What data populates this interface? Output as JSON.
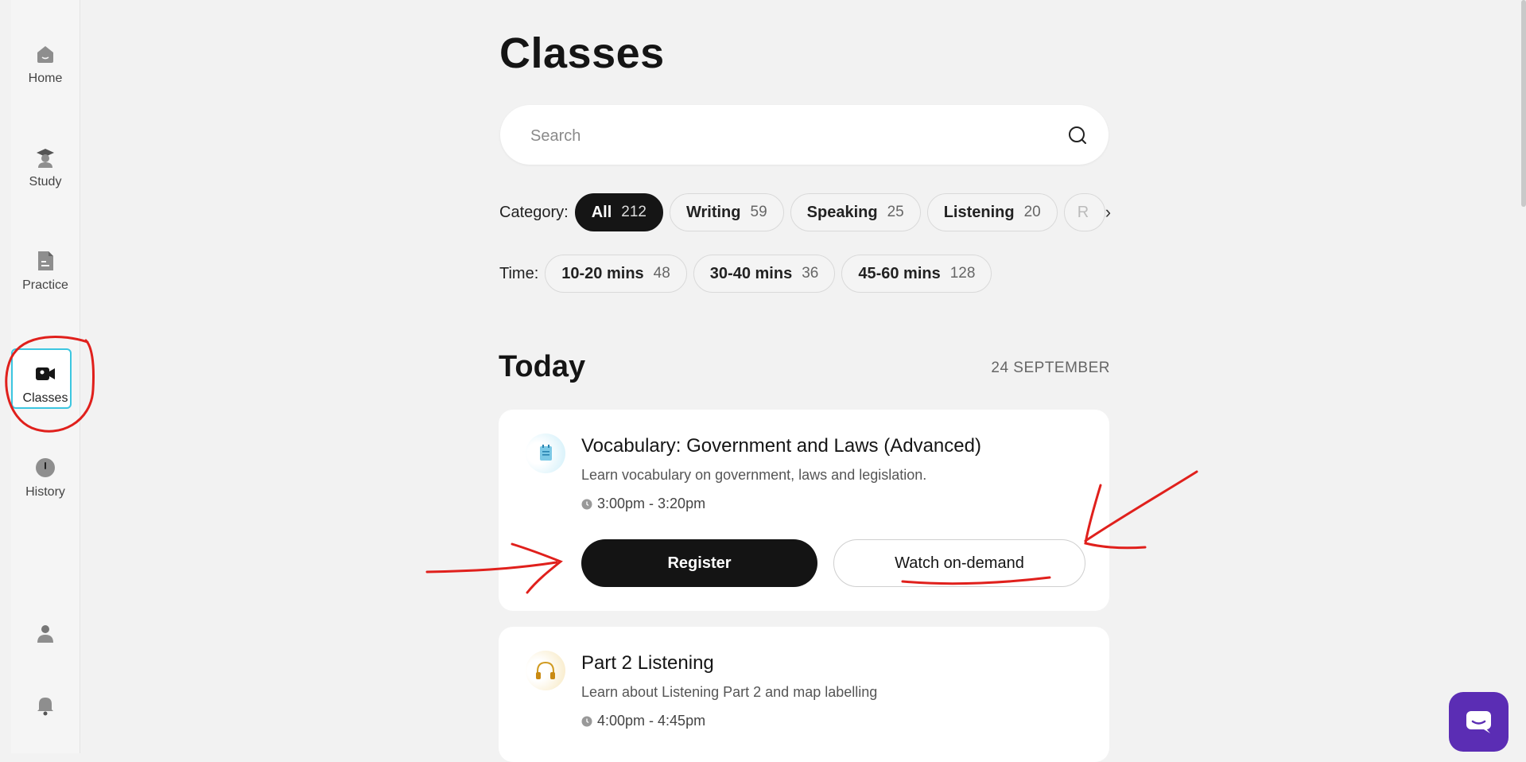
{
  "sidebar": {
    "items": [
      {
        "label": "Home",
        "icon": "home-icon"
      },
      {
        "label": "Study",
        "icon": "graduation-cap-icon"
      },
      {
        "label": "Practice",
        "icon": "document-icon"
      },
      {
        "label": "Classes",
        "icon": "video-camera-icon",
        "active": true
      },
      {
        "label": "History",
        "icon": "clock-icon"
      }
    ],
    "bottom_icons": [
      "user-icon",
      "bell-icon"
    ]
  },
  "page": {
    "title": "Classes",
    "search_placeholder": "Search"
  },
  "filters": {
    "category_label": "Category:",
    "categories": [
      {
        "label": "All",
        "count": "212",
        "active": true
      },
      {
        "label": "Writing",
        "count": "59"
      },
      {
        "label": "Speaking",
        "count": "25"
      },
      {
        "label": "Listening",
        "count": "20"
      },
      {
        "label": "R"
      }
    ],
    "time_label": "Time:",
    "times": [
      {
        "label": "10-20 mins",
        "count": "48"
      },
      {
        "label": "30-40 mins",
        "count": "36"
      },
      {
        "label": "45-60 mins",
        "count": "128"
      }
    ]
  },
  "section": {
    "title": "Today",
    "date": "24 SEPTEMBER"
  },
  "classes": [
    {
      "title": "Vocabulary: Government and Laws (Advanced)",
      "description": "Learn vocabulary on government, laws and legislation.",
      "time": "3:00pm - 3:20pm",
      "register_label": "Register",
      "watch_label": "Watch on-demand",
      "icon": "notepad-icon"
    },
    {
      "title": "Part 2 Listening",
      "description": "Learn about Listening Part 2 and map labelling",
      "time": "4:00pm - 4:45pm",
      "icon": "headphones-icon"
    }
  ],
  "colors": {
    "accent": "#151515",
    "active_outline": "#3cc6e0",
    "chat": "#5b2db4",
    "annotation": "#e0201c"
  }
}
